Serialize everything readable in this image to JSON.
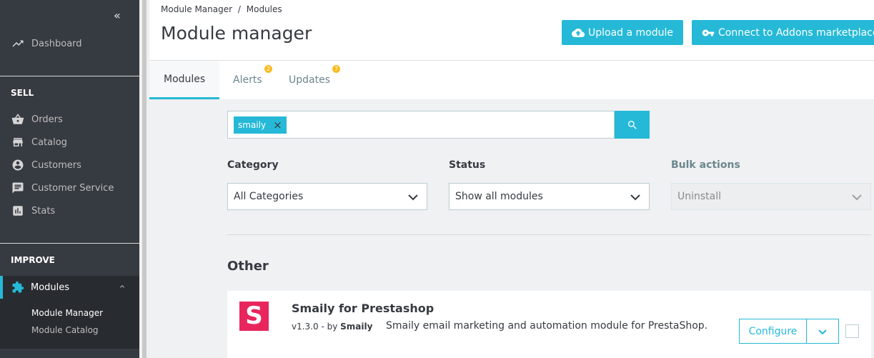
{
  "sidebar": {
    "collapse_icon": "«",
    "dashboard": "Dashboard",
    "sell_heading": "SELL",
    "orders": "Orders",
    "catalog": "Catalog",
    "customers": "Customers",
    "customer_service": "Customer Service",
    "stats": "Stats",
    "improve_heading": "IMPROVE",
    "modules": "Modules",
    "module_manager": "Module Manager",
    "module_catalog": "Module Catalog"
  },
  "header": {
    "breadcrumb": [
      "Module Manager",
      "/",
      "Modules"
    ],
    "title": "Module manager",
    "upload_button": "Upload a module",
    "connect_button": "Connect to Addons marketplace"
  },
  "tabs": {
    "modules": "Modules",
    "alerts": "Alerts",
    "alerts_badge": "2",
    "updates": "Updates",
    "updates_badge": "7"
  },
  "search": {
    "tag": "smaily",
    "tag_remove": "×"
  },
  "filters": {
    "category_label": "Category",
    "category_value": "All Categories",
    "status_label": "Status",
    "status_value": "Show all modules",
    "bulk_label": "Bulk actions",
    "bulk_value": "Uninstall"
  },
  "section": {
    "title": "Other"
  },
  "module": {
    "logo_letter": "S",
    "logo_color": "#e8255d",
    "name": "Smaily for Prestashop",
    "version_prefix": "v1.3.0 - by",
    "author": "Smaily",
    "description": "Smaily email marketing and automation module for PrestaShop.",
    "configure_label": "Configure"
  },
  "colors": {
    "accent": "#25b9d7",
    "sidebar_bg": "#363a41",
    "badge": "#fbbb22"
  }
}
